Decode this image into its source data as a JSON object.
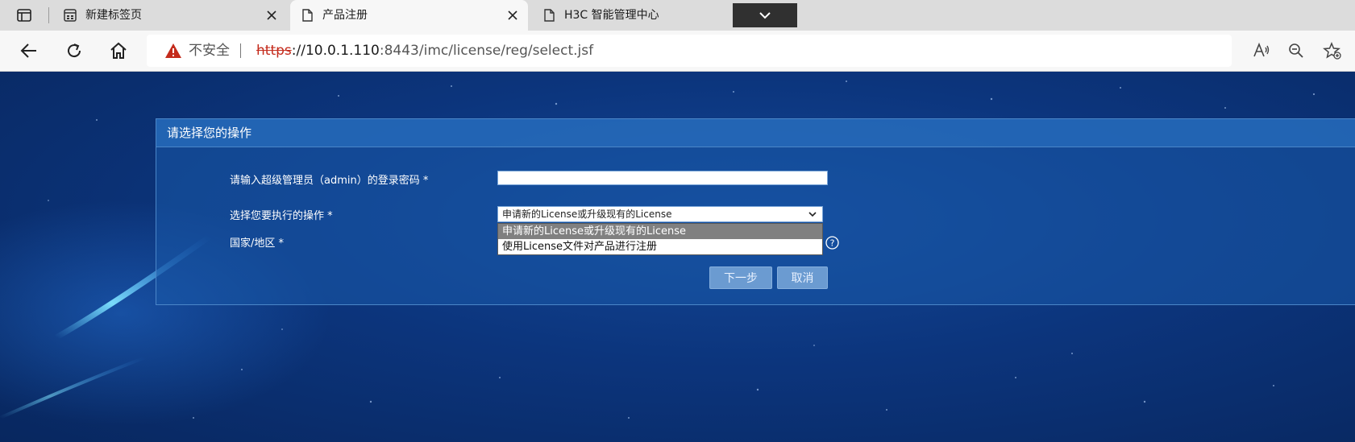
{
  "browser": {
    "tabs": [
      {
        "label": "新建标签页",
        "active": false
      },
      {
        "label": "产品注册",
        "active": true
      },
      {
        "label": "H3C 智能管理中心",
        "active": false
      }
    ],
    "address": {
      "security_label": "不安全",
      "url_protocol": "https",
      "url_host": "://10.0.1.110",
      "url_rest": ":8443/imc/license/reg/select.jsf"
    }
  },
  "form": {
    "title": "请选择您的操作",
    "password_label": "请输入超级管理员（admin）的登录密码 *",
    "password_value": "",
    "operation_label": "选择您要执行的操作 *",
    "operation_selected": "申请新的License或升级现有的License",
    "operation_options": [
      "申请新的License或升级现有的License",
      "使用License文件对产品进行注册"
    ],
    "country_label": "国家/地区 *",
    "next_label": "下一步",
    "cancel_label": "取消"
  },
  "colors": {
    "accent": "#6b9bd1",
    "warning": "#c42b1c",
    "page_bg": "#0c357d"
  }
}
